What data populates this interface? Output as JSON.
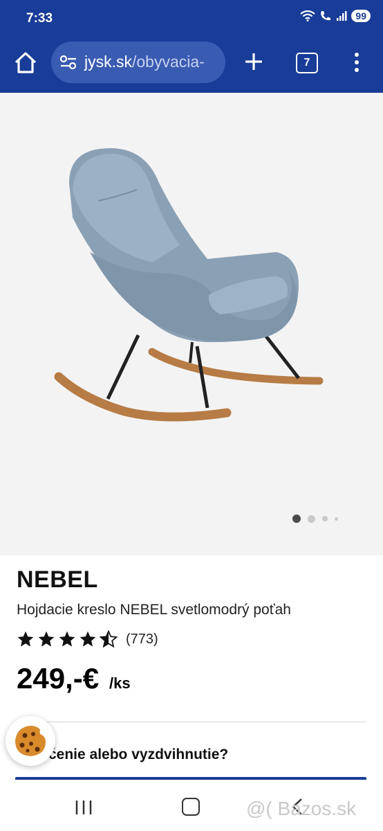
{
  "status_bar": {
    "time": "7:33",
    "battery": "99"
  },
  "browser": {
    "url_domain": "jysk.sk",
    "url_path": "/obyvacia-",
    "tab_count": "7"
  },
  "gallery": {
    "image_count": 4,
    "active_index": 0
  },
  "product": {
    "name": "NEBEL",
    "description": "Hojdacie kreslo NEBEL svetlomodrý poťah",
    "rating": 4.5,
    "rating_count": "(773)",
    "price": "249,-€",
    "unit": "/ks"
  },
  "delivery": {
    "question": "čenie alebo vyzdvihnutie?"
  },
  "watermark": "@( Bazos.sk",
  "colors": {
    "brand_blue": "#183c98",
    "chair_blue": "#8da3b8",
    "wood": "#b77c45"
  }
}
